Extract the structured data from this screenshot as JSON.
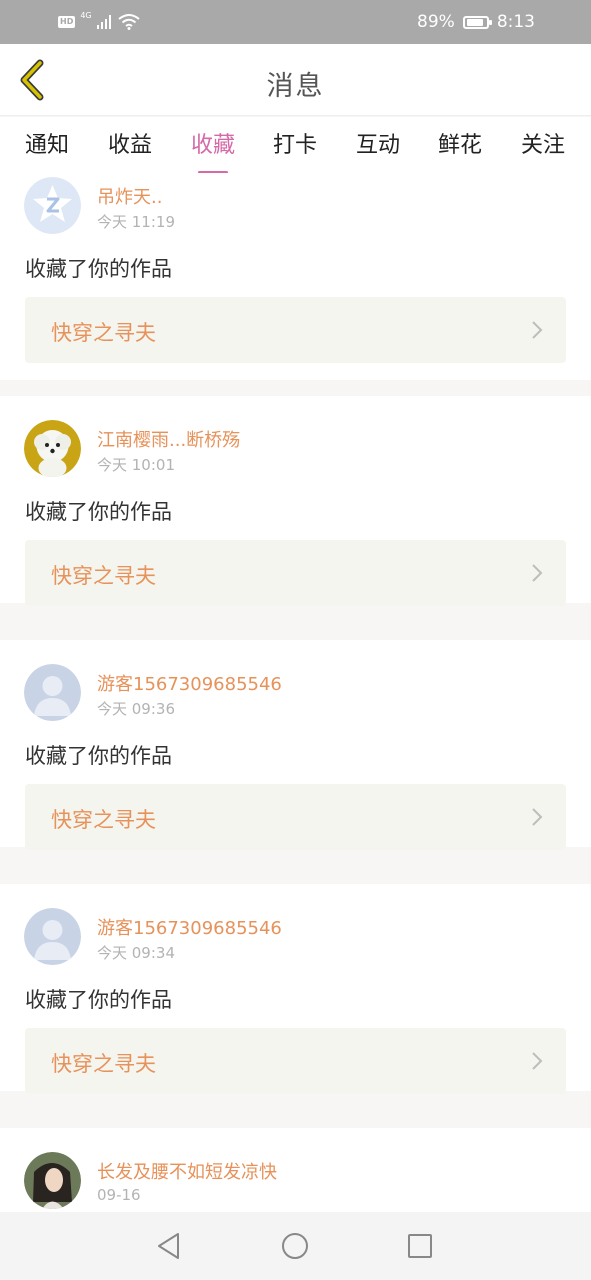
{
  "status_bar": {
    "hd_label": "HD",
    "network_label": "4G",
    "battery_percent": "89%",
    "battery_level": 0.89,
    "time": "8:13",
    "icons": [
      "hd-icon",
      "signal-icon",
      "wifi-icon",
      "battery-icon"
    ]
  },
  "nav": {
    "title": "消息",
    "back_icon": "chevron-left-icon",
    "accent_color": "#d6c200"
  },
  "tabs": [
    {
      "label": "通知",
      "active": false
    },
    {
      "label": "收益",
      "active": false
    },
    {
      "label": "收藏",
      "active": true
    },
    {
      "label": "打卡",
      "active": false
    },
    {
      "label": "互动",
      "active": false
    },
    {
      "label": "鲜花",
      "active": false
    },
    {
      "label": "关注",
      "active": false
    }
  ],
  "colors": {
    "active_tab": "#d46aa8",
    "name_text": "#e6925a",
    "work_box_bg": "#f5f5ef"
  },
  "messages": [
    {
      "user": "吊炸天..",
      "time": "今天 11:19",
      "action": "收藏了你的作品",
      "work": "快穿之寻夫",
      "avatar": "qq-avatar-icon"
    },
    {
      "user": "江南樱雨...断桥殇",
      "time": "今天 10:01",
      "action": "收藏了你的作品",
      "work": "快穿之寻夫",
      "avatar": "dog-photo-avatar"
    },
    {
      "user": "游客1567309685546",
      "time": "今天 09:36",
      "action": "收藏了你的作品",
      "work": "快穿之寻夫",
      "avatar": "default-user-avatar"
    },
    {
      "user": "游客1567309685546",
      "time": "今天 09:34",
      "action": "收藏了你的作品",
      "work": "快穿之寻夫",
      "avatar": "default-user-avatar"
    },
    {
      "user": "长发及腰不如短发凉快",
      "time": "09-16",
      "action": "",
      "work": "",
      "avatar": "girl-photo-avatar"
    }
  ],
  "bottom_nav": {
    "icons": [
      "back-triangle-icon",
      "home-circle-icon",
      "recents-square-icon"
    ]
  }
}
